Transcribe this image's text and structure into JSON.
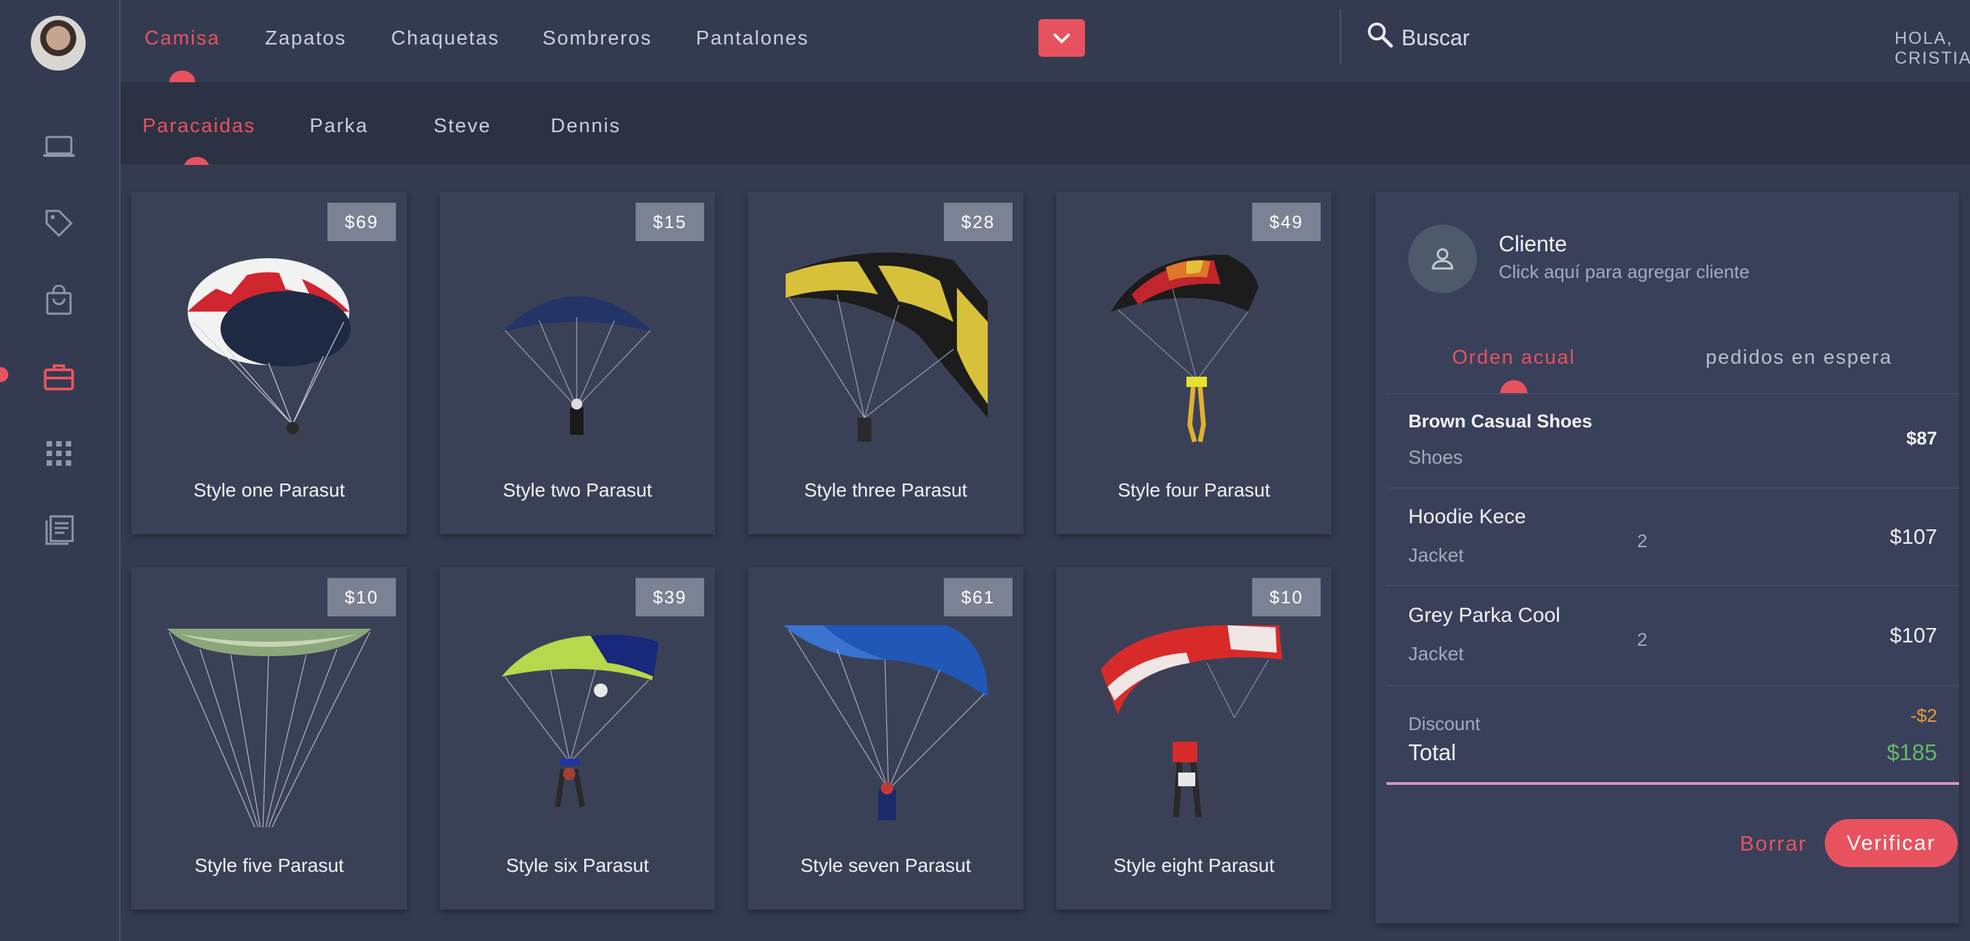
{
  "header": {
    "categories": [
      {
        "label": "Camisa",
        "active": true
      },
      {
        "label": "Zapatos"
      },
      {
        "label": "Chaquetas"
      },
      {
        "label": "Sombreros"
      },
      {
        "label": "Pantalones"
      }
    ],
    "search_placeholder": "Buscar",
    "user_menu_label": "HOLA, CRISTIAN"
  },
  "subcategories": [
    {
      "label": "Paracaidas",
      "active": true
    },
    {
      "label": "Parka"
    },
    {
      "label": "Steve"
    },
    {
      "label": "Dennis"
    }
  ],
  "sidebar": {
    "icons": [
      "laptop-icon",
      "tag-icon",
      "shopping-bag-icon",
      "briefcase-icon",
      "grid-icon",
      "list-icon"
    ],
    "active_index": 3
  },
  "products": [
    {
      "name": "Style one Parasut",
      "price": "$69"
    },
    {
      "name": "Style two Parasut",
      "price": "$15"
    },
    {
      "name": "Style three Parasut",
      "price": "$28"
    },
    {
      "name": "Style four Parasut",
      "price": "$49"
    },
    {
      "name": "Style five Parasut",
      "price": "$10"
    },
    {
      "name": "Style six Parasut",
      "price": "$39"
    },
    {
      "name": "Style seven Parasut",
      "price": "$61"
    },
    {
      "name": "Style eight Parasut",
      "price": "$10"
    }
  ],
  "order": {
    "client_title": "Cliente",
    "client_subtitle": "Click aquí para agregar cliente",
    "tabs": [
      {
        "label": "Orden acual",
        "active": true
      },
      {
        "label": "pedidos en espera"
      }
    ],
    "items": [
      {
        "name": "Brown Casual Shoes",
        "category": "Shoes",
        "qty": "",
        "price": "$87"
      },
      {
        "name": "Hoodie Kece",
        "category": "Jacket",
        "qty": "2",
        "price": "$107"
      },
      {
        "name": "Grey Parka Cool",
        "category": "Jacket",
        "qty": "2",
        "price": "$107"
      }
    ],
    "discount_label": "Discount",
    "discount_value": "-$2",
    "total_label": "Total",
    "total_value": "$185",
    "clear_label": "Borrar",
    "checkout_label": "Verificar"
  },
  "colors": {
    "accent": "#e8525f",
    "background": "#343b50",
    "total_green": "#64b86a",
    "discount_orange": "#e89a3c"
  }
}
